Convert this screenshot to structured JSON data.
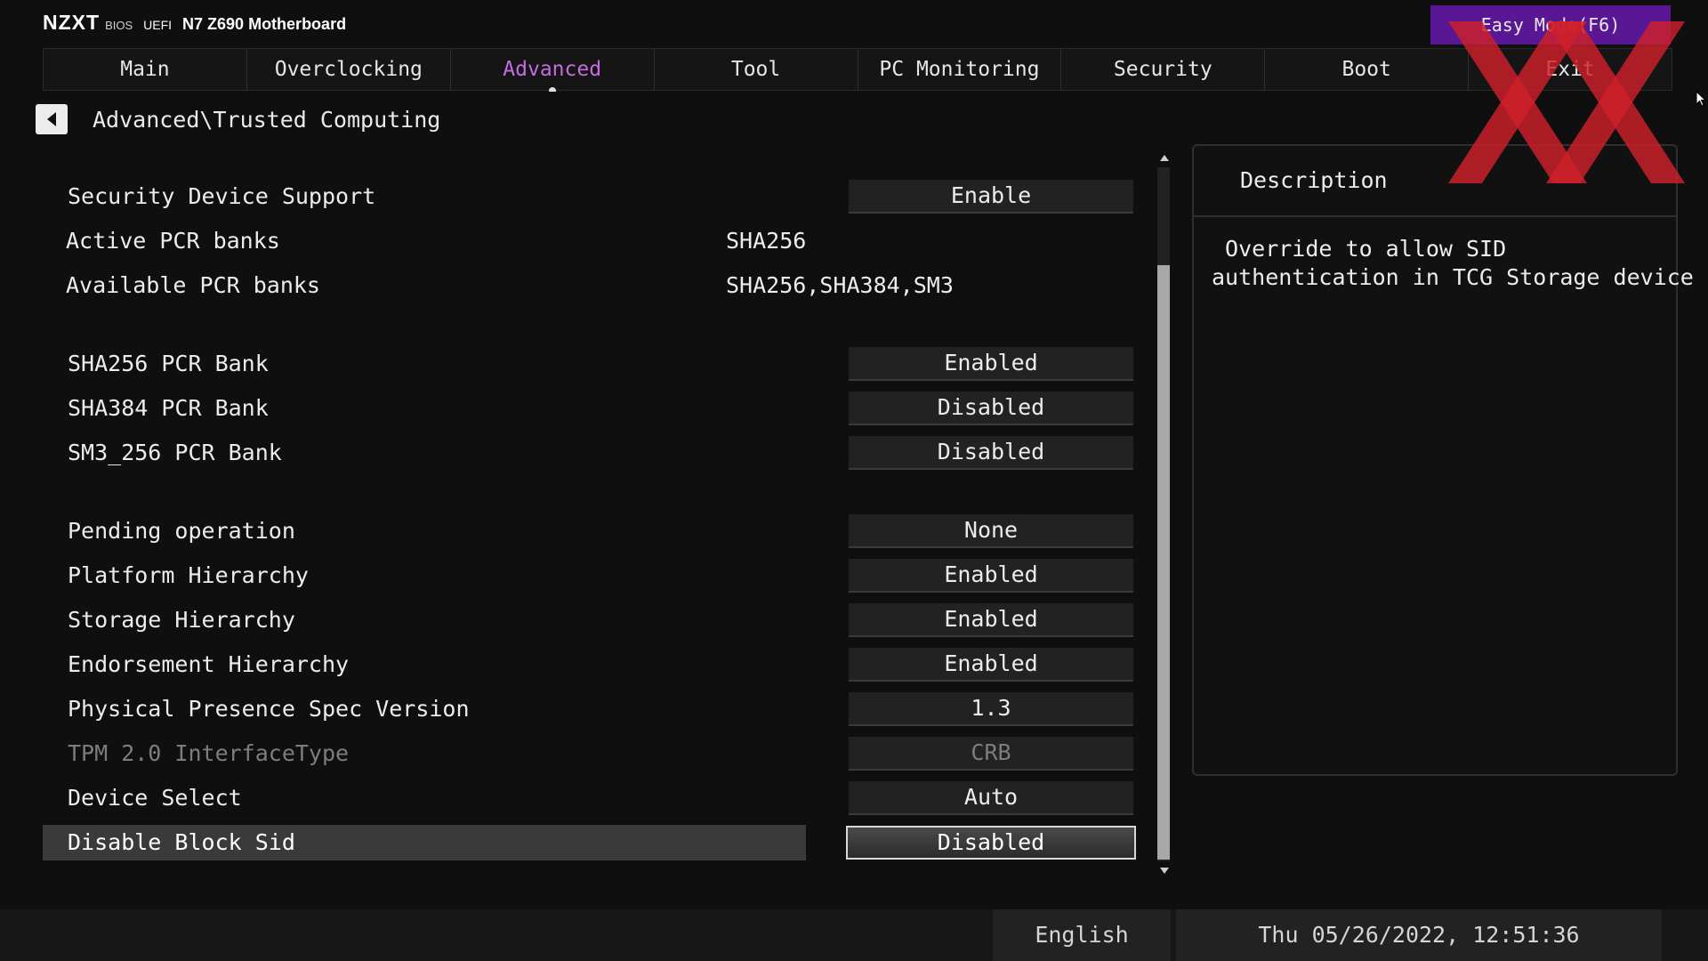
{
  "header": {
    "brand_logo": "NZXT",
    "brand_bios": "BIOS",
    "brand_uefi": "UEFI",
    "model": "N7 Z690 Motherboard",
    "easy_mode": "Easy Mode(F6)"
  },
  "tabs": [
    {
      "label": "Main"
    },
    {
      "label": "Overclocking"
    },
    {
      "label": "Advanced",
      "active": true
    },
    {
      "label": "Tool"
    },
    {
      "label": "PC Monitoring"
    },
    {
      "label": "Security"
    },
    {
      "label": "Boot"
    },
    {
      "label": "Exit"
    }
  ],
  "breadcrumb": "Advanced\\Trusted Computing",
  "settings": [
    {
      "label": "Security Device Support",
      "value": "Enable"
    },
    {
      "label": "Active PCR banks",
      "value": "SHA256"
    },
    {
      "label": "Available PCR banks",
      "value": "SHA256,SHA384,SM3"
    },
    {
      "label": "SHA256 PCR Bank",
      "value": "Enabled"
    },
    {
      "label": "SHA384 PCR Bank",
      "value": "Disabled"
    },
    {
      "label": "SM3_256 PCR Bank",
      "value": "Disabled"
    },
    {
      "label": "Pending operation",
      "value": "None"
    },
    {
      "label": "Platform Hierarchy",
      "value": "Enabled"
    },
    {
      "label": "Storage Hierarchy",
      "value": "Enabled"
    },
    {
      "label": "Endorsement Hierarchy",
      "value": "Enabled"
    },
    {
      "label": "Physical Presence Spec Version",
      "value": "1.3"
    },
    {
      "label": "TPM 2.0 InterfaceType",
      "value": "CRB"
    },
    {
      "label": "Device Select",
      "value": "Auto"
    },
    {
      "label": "Disable Block Sid",
      "value": "Disabled"
    }
  ],
  "description": {
    "title": "Description",
    "text": " Override to allow SID\nauthentication in TCG Storage device"
  },
  "footer": {
    "language": "English",
    "datetime": "Thu 05/26/2022, 12:51:36"
  },
  "colors": {
    "accent": "#c66be0",
    "easy_mode_bg": "#5a1794",
    "background": "#0f0f0f",
    "watermark": "#d0202a"
  }
}
